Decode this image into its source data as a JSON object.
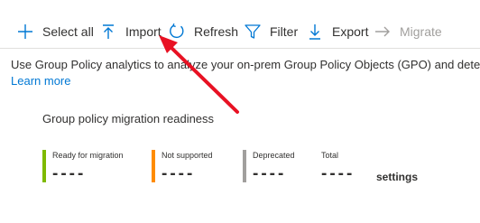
{
  "toolbar": {
    "items": [
      {
        "label": "Select all",
        "icon": "plus-icon",
        "disabled": false
      },
      {
        "label": "Import",
        "icon": "upload-arrow-icon",
        "disabled": false
      },
      {
        "label": "Refresh",
        "icon": "refresh-icon",
        "disabled": false
      },
      {
        "label": "Filter",
        "icon": "filter-icon",
        "disabled": false
      },
      {
        "label": "Export",
        "icon": "download-arrow-icon",
        "disabled": false
      },
      {
        "label": "Migrate",
        "icon": "arrow-right-icon",
        "disabled": true
      }
    ]
  },
  "description": "Use Group Policy analytics to analyze your on-prem Group Policy Objects (GPO) and determ",
  "learn_more": "Learn more",
  "panel": {
    "title": "Group policy migration readiness",
    "stats": [
      {
        "label": "Ready for migration",
        "value": "----",
        "color": "#7fba00"
      },
      {
        "label": "Not supported",
        "value": "----",
        "color": "#ff8c00"
      },
      {
        "label": "Deprecated",
        "value": "----",
        "color": "#a19f9d"
      },
      {
        "label": "Total",
        "value": "----",
        "unit": "settings",
        "color": ""
      }
    ]
  },
  "colors": {
    "accent": "#0078d4",
    "annotation_arrow": "#e81123"
  }
}
